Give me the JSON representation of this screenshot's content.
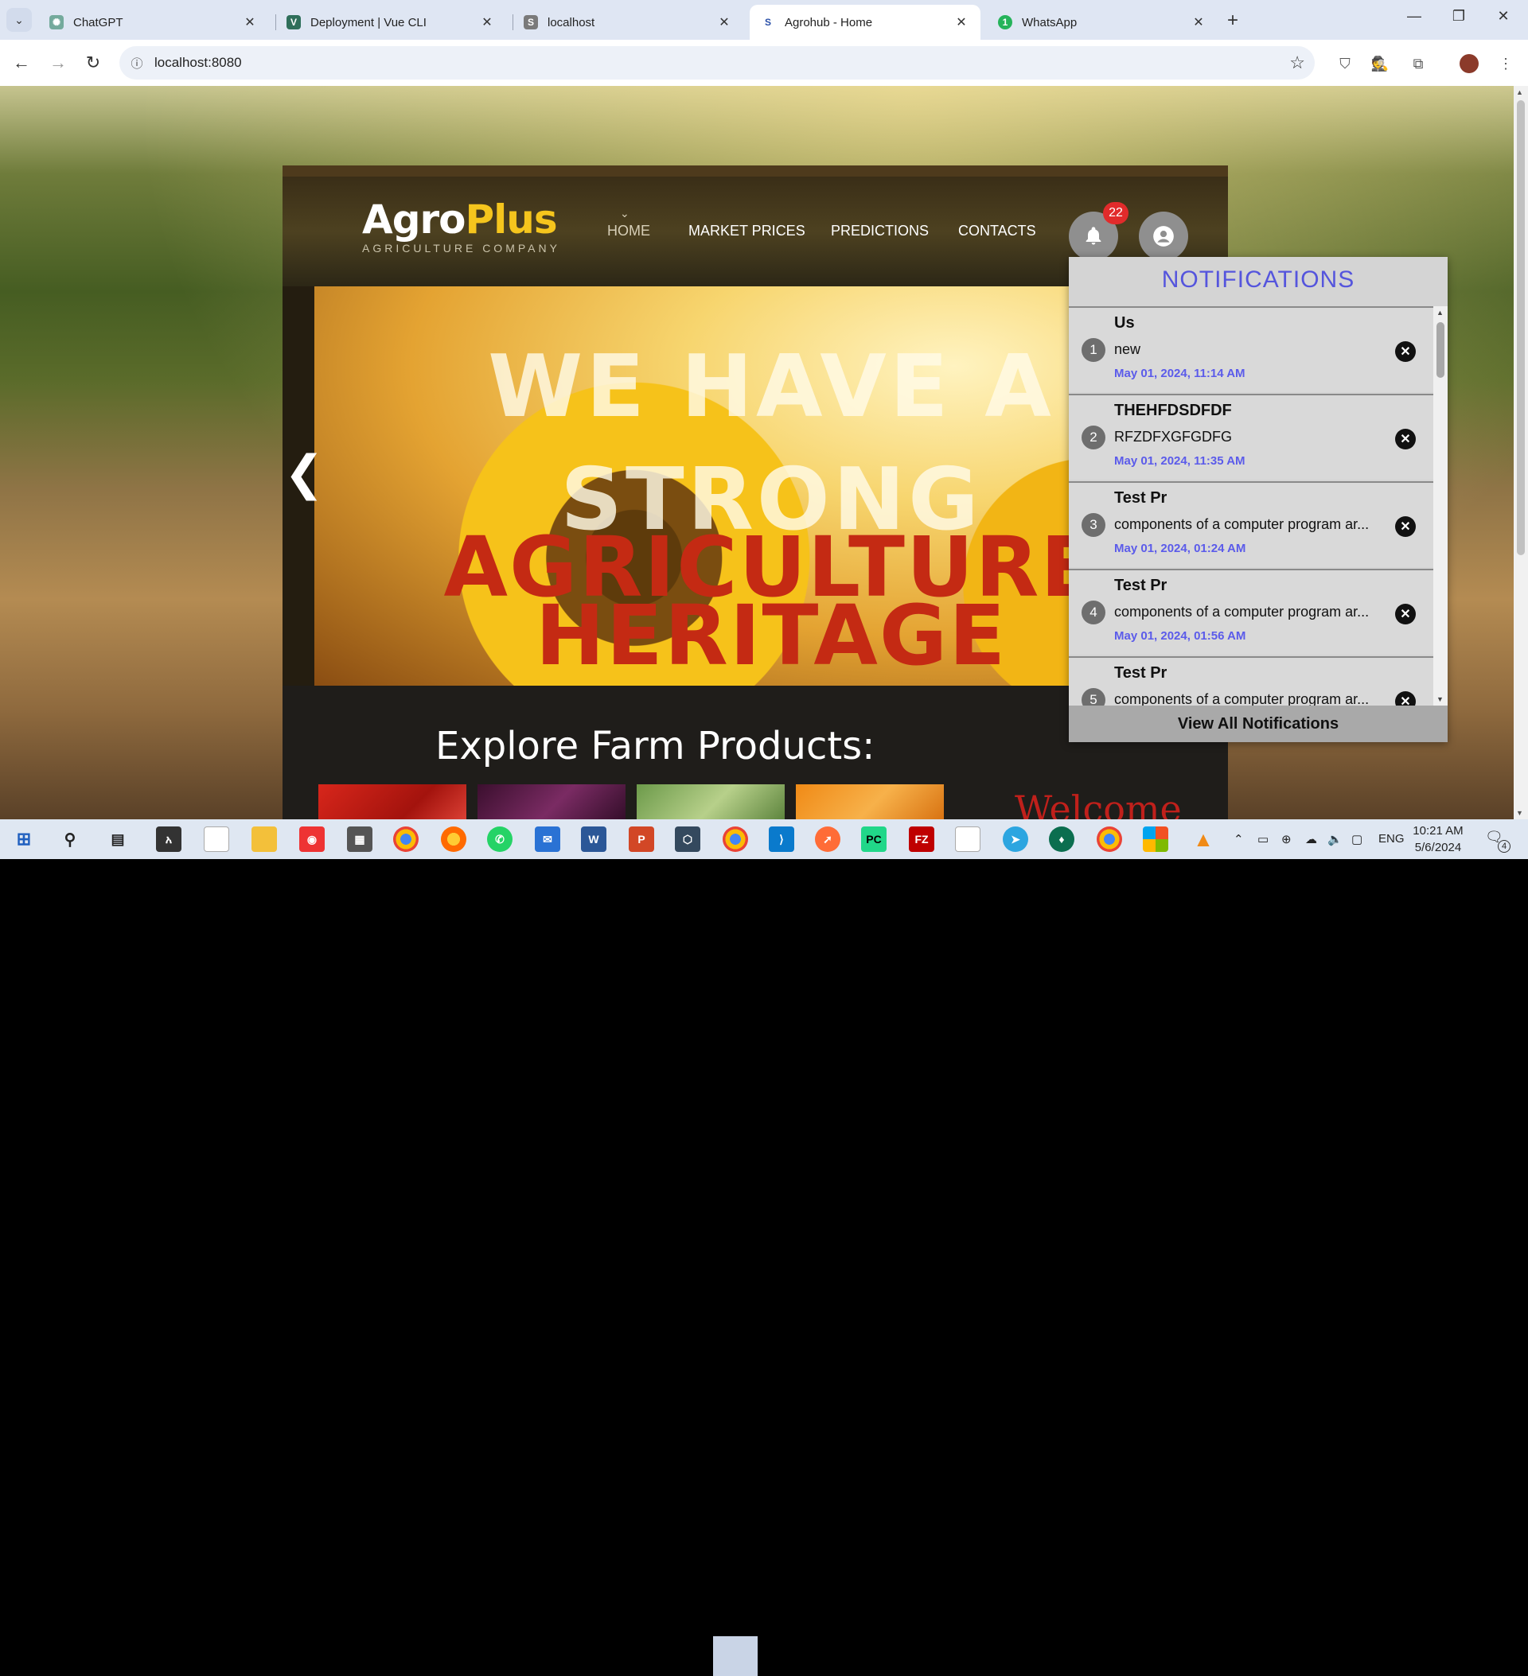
{
  "browser": {
    "tabs": [
      {
        "title": "ChatGPT",
        "icon": "chatgpt-favicon"
      },
      {
        "title": "Deployment | Vue CLI",
        "icon": "vue-favicon"
      },
      {
        "title": "localhost",
        "icon": "site-favicon"
      },
      {
        "title": "Agrohub - Home",
        "icon": "site-favicon",
        "active": true
      },
      {
        "title": "WhatsApp",
        "icon": "whatsapp-favicon",
        "badge": "1"
      }
    ],
    "url": "localhost:8080"
  },
  "site": {
    "logo": {
      "main_a": "Agro",
      "main_b": "Plus",
      "subtitle": "AGRICULTURE COMPANY"
    },
    "nav": [
      {
        "label": "HOME",
        "current": true
      },
      {
        "label": "MARKET PRICES"
      },
      {
        "label": "PREDICTIONS"
      },
      {
        "label": "CONTACTS"
      }
    ],
    "notification_badge": "22",
    "hero": {
      "line1": "WE HAVE A",
      "line2": "STRONG",
      "line3": "AGRICULTURE",
      "line4": "HERITAGE",
      "prev_arrow": "❮"
    },
    "explore_title": "Explore Farm Products:",
    "welcome": "Welcome"
  },
  "notifications": {
    "title": "NOTIFICATIONS",
    "items": [
      {
        "num": "1",
        "title": "Us",
        "body": "new",
        "time": "May 01, 2024, 11:14 AM"
      },
      {
        "num": "2",
        "title": "THEHFDSDFDF",
        "body": "RFZDFXGFGDFG",
        "time": "May 01, 2024, 11:35 AM"
      },
      {
        "num": "3",
        "title": "Test Pr",
        "body": "components of a computer program ar...",
        "time": "May 01, 2024, 01:24 AM"
      },
      {
        "num": "4",
        "title": "Test Pr",
        "body": "components of a computer program ar...",
        "time": "May 01, 2024, 01:56 AM"
      },
      {
        "num": "5",
        "title": "Test Pr",
        "body": "components of a computer program ar...",
        "time": ""
      }
    ],
    "view_all": "View All Notifications"
  },
  "taskbar": {
    "language": "ENG",
    "time": "10:21 AM",
    "date": "5/6/2024",
    "notification_count": "4"
  },
  "colors": {
    "accent_blue": "#5b5bea",
    "badge_red": "#e12b2b",
    "logo_yellow": "#f5c51d",
    "hero_red": "#c42a13"
  }
}
